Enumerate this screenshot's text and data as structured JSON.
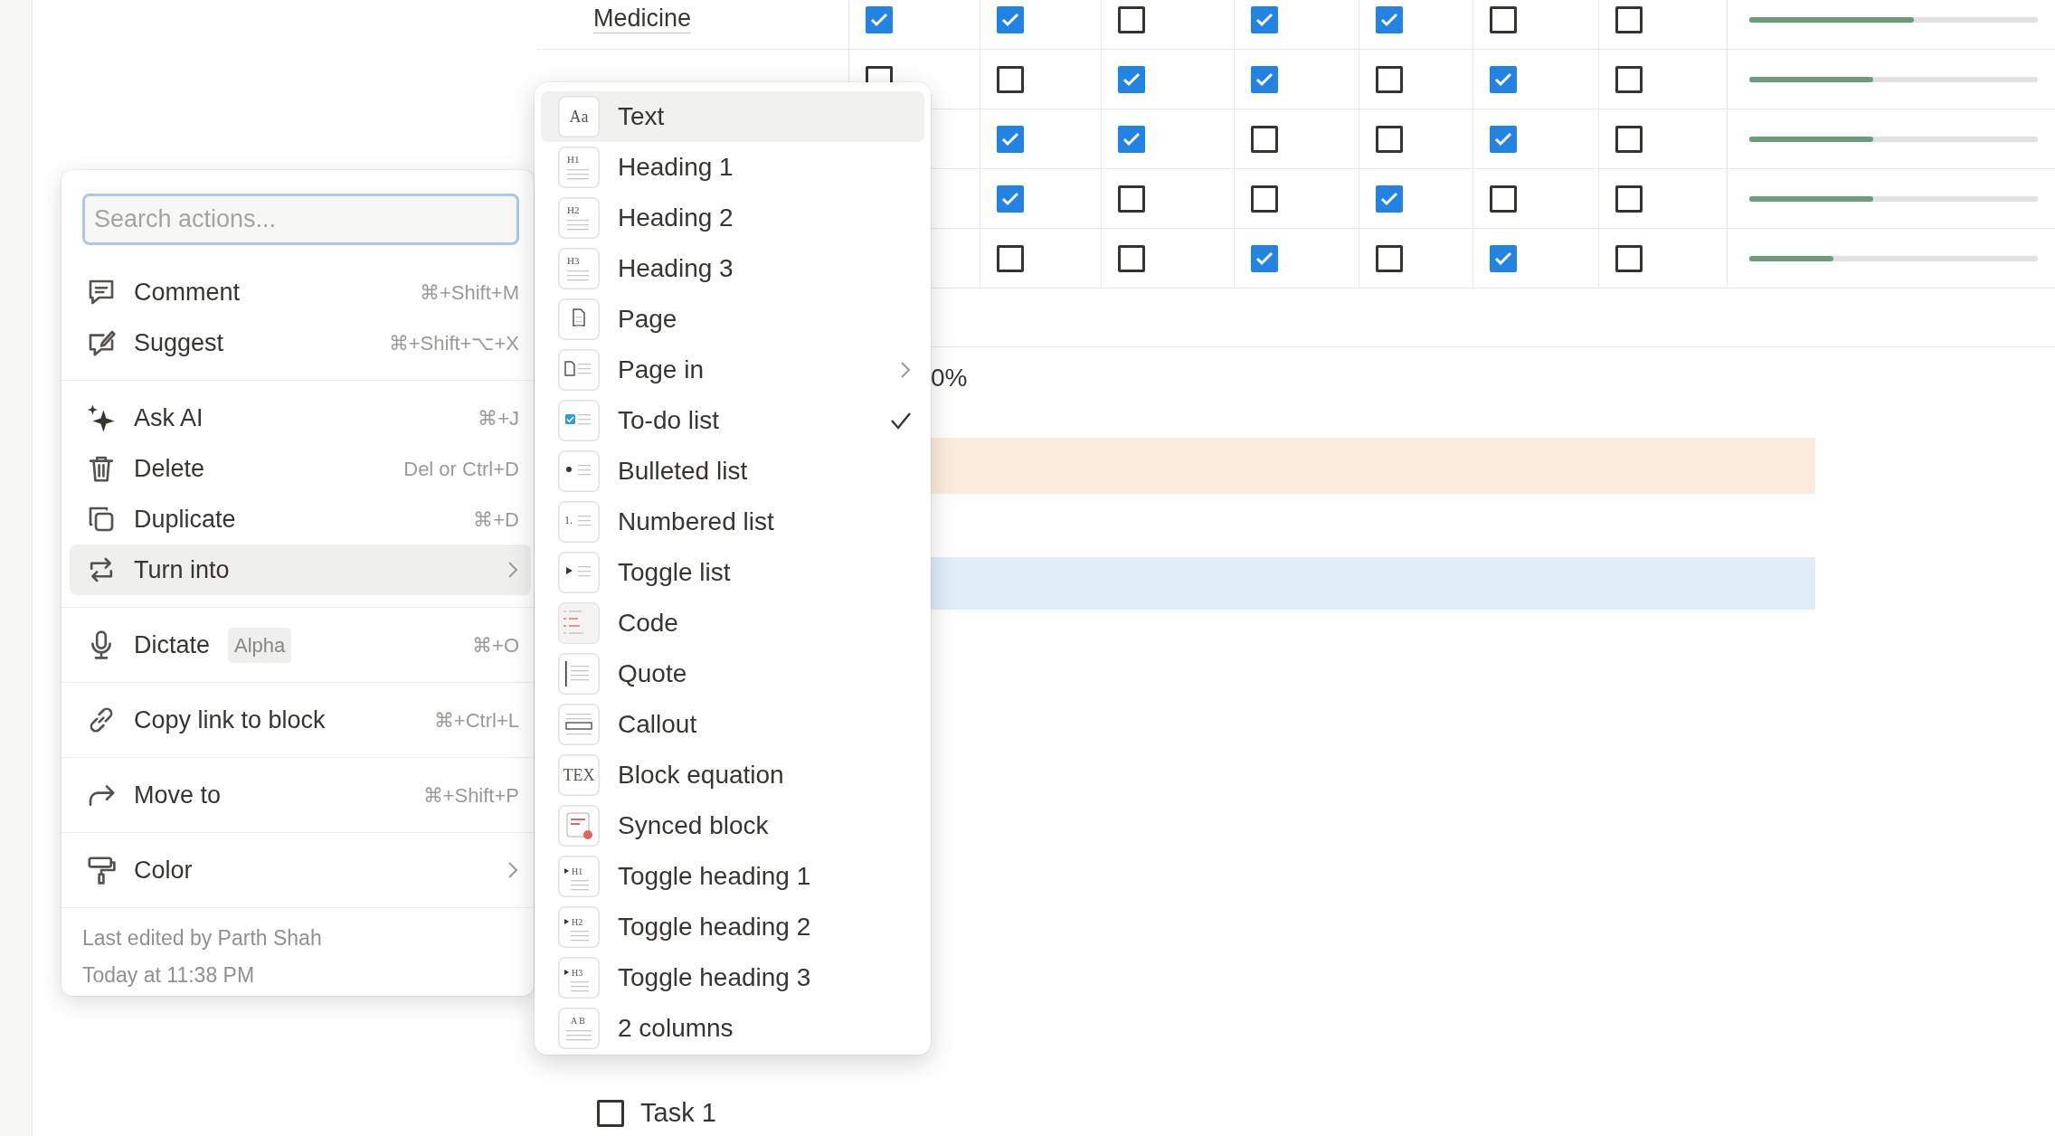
{
  "table": {
    "rows": [
      {
        "name": "Medicine",
        "checks": [
          true,
          true,
          false,
          true,
          true,
          false,
          false
        ],
        "level": 0.57
      },
      {
        "checks": [
          false,
          false,
          true,
          true,
          false,
          true,
          false
        ],
        "level": 0.43
      },
      {
        "checks": [
          true,
          true,
          false,
          false,
          true,
          false
        ],
        "level": 0.43
      },
      {
        "checks": [
          true,
          false,
          false,
          true,
          false,
          false
        ],
        "level": 0.43
      },
      {
        "checks": [
          false,
          false,
          true,
          false,
          true,
          false
        ],
        "level": 0.29
      }
    ]
  },
  "partial_text": "0%",
  "bands": [
    {
      "color": "#fbecdd"
    },
    {
      "color": "#e1ecf9"
    }
  ],
  "todo": {
    "label": "Task 1",
    "checked": false
  },
  "actions_menu": {
    "search": {
      "placeholder": "Search actions..."
    },
    "groups": [
      [
        {
          "label": "Comment",
          "shortcut": "⌘+Shift+M",
          "kind": "comment",
          "selected": false
        },
        {
          "label": "Suggest",
          "shortcut": "⌘+Shift+⌥+X",
          "kind": "suggest",
          "selected": false
        }
      ],
      [
        {
          "label": "Ask AI",
          "shortcut": "⌘+J",
          "kind": "sparkle",
          "selected": false
        },
        {
          "label": "Delete",
          "shortcut": "Del or Ctrl+D",
          "kind": "trash",
          "selected": false
        },
        {
          "label": "Duplicate",
          "shortcut": "⌘+D",
          "kind": "duplicate",
          "selected": false
        },
        {
          "label": "Turn into",
          "kind": "convert",
          "submenu": true,
          "selected": true
        }
      ],
      [
        {
          "label": "Dictate",
          "badge": "Alpha",
          "shortcut": "⌘+O",
          "kind": "mic",
          "selected": false
        }
      ],
      [
        {
          "label": "Copy link to block",
          "shortcut": "⌘+Ctrl+L",
          "kind": "link",
          "selected": false
        }
      ],
      [
        {
          "label": "Move to",
          "shortcut": "⌘+Shift+P",
          "kind": "forward",
          "selected": false
        }
      ],
      [
        {
          "label": "Color",
          "kind": "roller",
          "submenu": true,
          "selected": false
        }
      ]
    ],
    "footer": [
      "Last edited by Parth Shah",
      "Today at 11:38 PM"
    ]
  },
  "turn_into_menu": {
    "items": [
      {
        "label": "Text",
        "kind": "plain",
        "glyph": "Aa",
        "selected": true,
        "checked": false
      },
      {
        "label": "Heading 1",
        "kind": "heading",
        "glyph": "H1",
        "selected": false,
        "checked": false
      },
      {
        "label": "Heading 2",
        "kind": "heading",
        "glyph": "H2",
        "selected": false,
        "checked": false
      },
      {
        "label": "Heading 3",
        "kind": "heading",
        "glyph": "H3",
        "selected": false,
        "checked": false
      },
      {
        "label": "Page",
        "kind": "page",
        "selected": false,
        "checked": false
      },
      {
        "label": "Page in",
        "kind": "page-lines",
        "submenu": true,
        "selected": false,
        "checked": false
      },
      {
        "label": "To-do list",
        "kind": "todo",
        "selected": false,
        "checked": true
      },
      {
        "label": "Bulleted list",
        "kind": "bullet",
        "selected": false,
        "checked": false
      },
      {
        "label": "Numbered list",
        "kind": "lines",
        "glyph": "1.",
        "selected": false,
        "checked": false
      },
      {
        "label": "Toggle list",
        "kind": "toggle",
        "selected": false,
        "checked": false
      },
      {
        "label": "Code",
        "kind": "code",
        "selected": false,
        "checked": false
      },
      {
        "label": "Quote",
        "kind": "quote",
        "selected": false,
        "checked": false
      },
      {
        "label": "Callout",
        "kind": "callout",
        "selected": false,
        "checked": false
      },
      {
        "label": "Block equation",
        "kind": "plain",
        "glyph": "TEX",
        "selected": false,
        "checked": false
      },
      {
        "label": "Synced block",
        "kind": "synced",
        "selected": false,
        "checked": false
      },
      {
        "label": "Toggle heading 1",
        "kind": "toggle-heading",
        "glyph": "H1",
        "selected": false,
        "checked": false
      },
      {
        "label": "Toggle heading 2",
        "kind": "toggle-heading",
        "glyph": "H2",
        "selected": false,
        "checked": false
      },
      {
        "label": "Toggle heading 3",
        "kind": "toggle-heading",
        "glyph": "H3",
        "selected": false,
        "checked": false
      },
      {
        "label": "2 columns",
        "kind": "columns",
        "glyph": "A B",
        "selected": false,
        "checked": false
      }
    ]
  }
}
